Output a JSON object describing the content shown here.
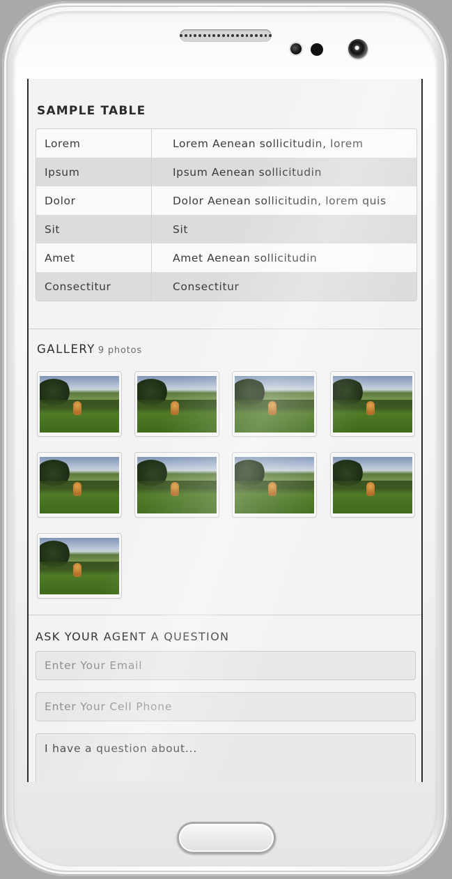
{
  "table": {
    "title": "SAMPLE TABLE",
    "rows": [
      {
        "label": "Lorem",
        "value": "Lorem Aenean sollicitudin, lorem"
      },
      {
        "label": "Ipsum",
        "value": "Ipsum Aenean sollicitudin"
      },
      {
        "label": "Dolor",
        "value": "Dolor Aenean sollicitudin, lorem quis"
      },
      {
        "label": "Sit",
        "value": "Sit"
      },
      {
        "label": "Amet",
        "value": "Amet Aenean sollicitudin"
      },
      {
        "label": "Consectitur",
        "value": "Consectitur"
      }
    ]
  },
  "gallery": {
    "title": "GALLERY",
    "count": "9 photos",
    "photos": 9
  },
  "contact": {
    "title": "ASK YOUR AGENT A QUESTION",
    "email_placeholder": "Enter Your Email",
    "phone_placeholder": "Enter Your Cell Phone",
    "question_value": "I have a question about..."
  }
}
